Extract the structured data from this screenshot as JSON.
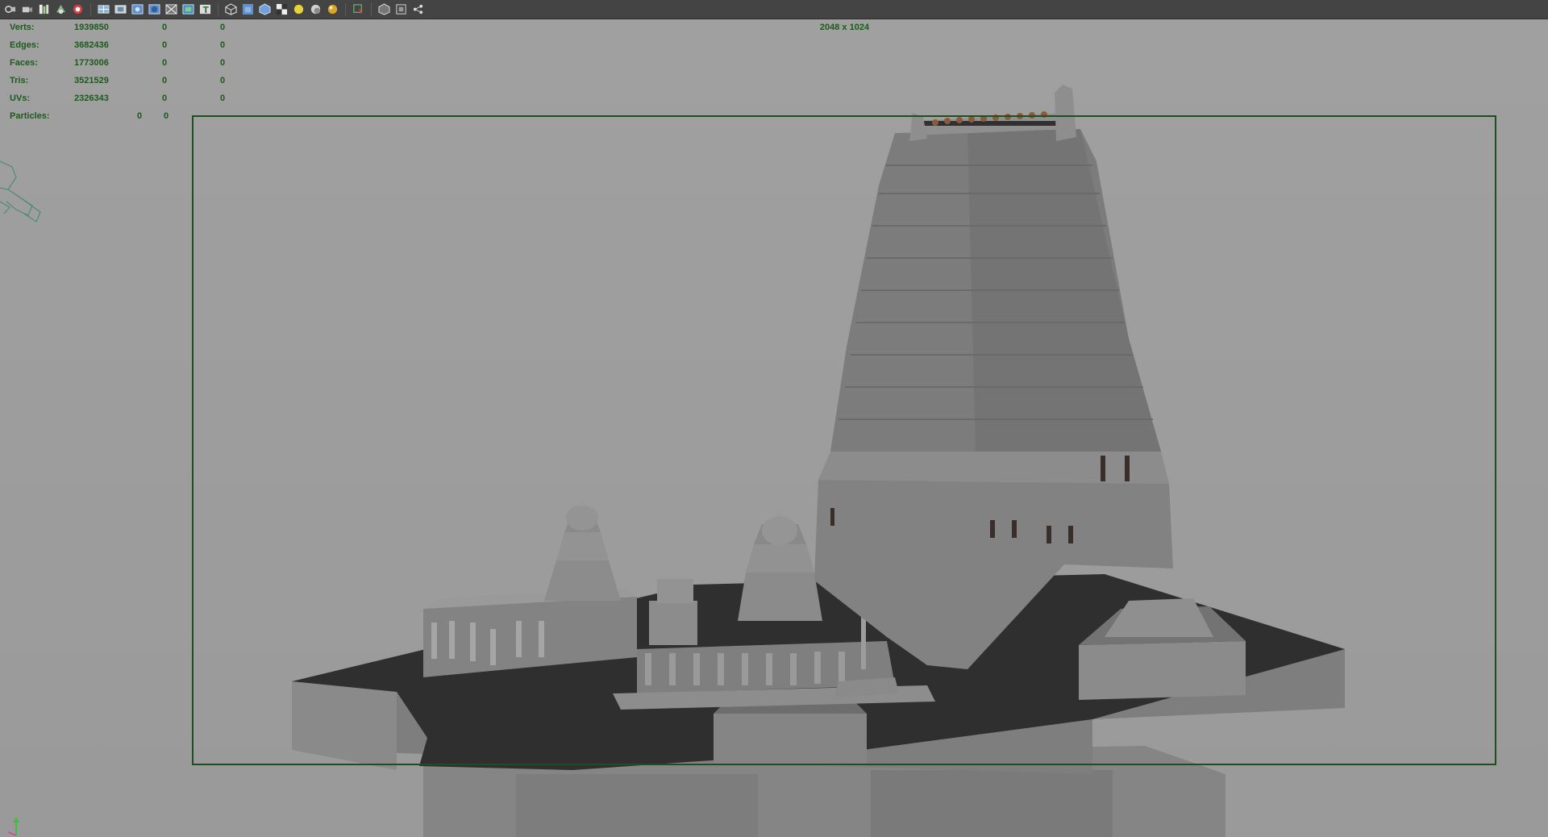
{
  "toolbar": {
    "icons": [
      "select-camera-icon",
      "camera-attributes-icon",
      "bookmarks-icon",
      "image-plane-icon",
      "two-d-pan-zoom-icon",
      "grease-pencil-icon",
      "grid-icon",
      "film-gate-icon",
      "resolution-gate-icon",
      "gate-mask-icon",
      "field-chart-icon",
      "safe-action-icon",
      "safe-title-icon",
      "wireframe-icon",
      "smooth-shade-icon",
      "default-material-icon",
      "textured-icon",
      "use-all-lights-icon",
      "shadows-icon",
      "screen-space-ao-icon",
      "isolate-select-icon",
      "xray-icon",
      "xray-joints-icon",
      "xray-components-icon"
    ]
  },
  "hud": {
    "rows": [
      {
        "label": "Verts:",
        "v1": "1939850",
        "v2": "0",
        "v3": "0"
      },
      {
        "label": "Edges:",
        "v1": "3682436",
        "v2": "0",
        "v3": "0"
      },
      {
        "label": "Faces:",
        "v1": "1773006",
        "v2": "0",
        "v3": "0"
      },
      {
        "label": "Tris:",
        "v1": "3521529",
        "v2": "0",
        "v3": "0"
      },
      {
        "label": "UVs:",
        "v1": "2326343",
        "v2": "0",
        "v3": "0"
      },
      {
        "label": "Particles:",
        "v1": "",
        "v2": "0",
        "v3": "0"
      }
    ]
  },
  "viewport": {
    "resolution_label": "2048 x 1024",
    "gate_color": "#1f4e1f",
    "hud_text_color": "#1d5a1d",
    "background_color": "#9e9e9e"
  }
}
